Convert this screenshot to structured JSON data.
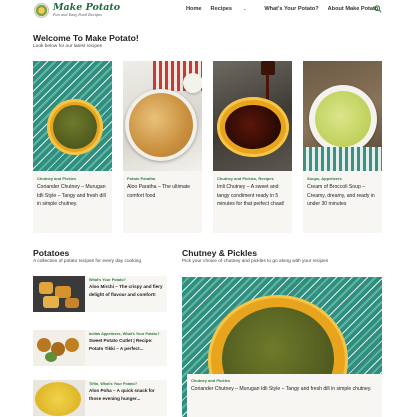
{
  "site": {
    "name": "Make Potato",
    "tagline": "Fun and Easy Food Recipes"
  },
  "nav": {
    "items": [
      "Home",
      "Recipes",
      "What's Your Potato?",
      "About Make Potato"
    ],
    "recipes_caret": "⌄"
  },
  "welcome": {
    "title": "Welcome To Make Potato!",
    "subtitle": "Look below for our latest recipes"
  },
  "featured": [
    {
      "tag": "Chutney and Pickles",
      "title": "Coriander Chutney – Murugan Idli Style – Tangy and fresh dill in simple chutney."
    },
    {
      "tag": "Potato Paratha",
      "title": "Aloo Paratha – The ultimate comfort food"
    },
    {
      "tag": "Chutney and Pickles, Recipes",
      "title": "Imli Chutney – A sweet and tangy condiment ready in 5 minutes for that perfect chaat!"
    },
    {
      "tag": "Soups, Appetizers",
      "title": "Cream of Broccoli Soup – Creamy, dreamy, and ready in under 30 minutes"
    }
  ],
  "potatoes": {
    "title": "Potatoes",
    "subtitle": "A collection of potato recipes for every day cooking",
    "items": [
      {
        "tag": "What's Your Potato?",
        "title": "Aloo Mirchi – The crispy and fiery delight of flavour and comfort!"
      },
      {
        "tag": "Indian Appetizers, What's Your Potato?",
        "title": "Sweet Potato Cutlet | Recipe: Potato Tikki – A perfect..."
      },
      {
        "tag": "Tiffin, What's Your Potato?",
        "title": "Aloo Poha – A quick snack for those evening hunger..."
      }
    ]
  },
  "chutney": {
    "title": "Chutney & Pickles",
    "subtitle": "Pick your choice of chutney and pickles to go along with your recipes",
    "feature": {
      "tag": "Chutney and Pickles",
      "title": "Coriander Chutney – Murugan Idli Style – Tangy and fresh dill in simple chutney."
    }
  },
  "colors": {
    "accent_green": "#2f7a3e",
    "logo_green": "#1f6b3d",
    "panel_bg": "#f7f6f3"
  }
}
